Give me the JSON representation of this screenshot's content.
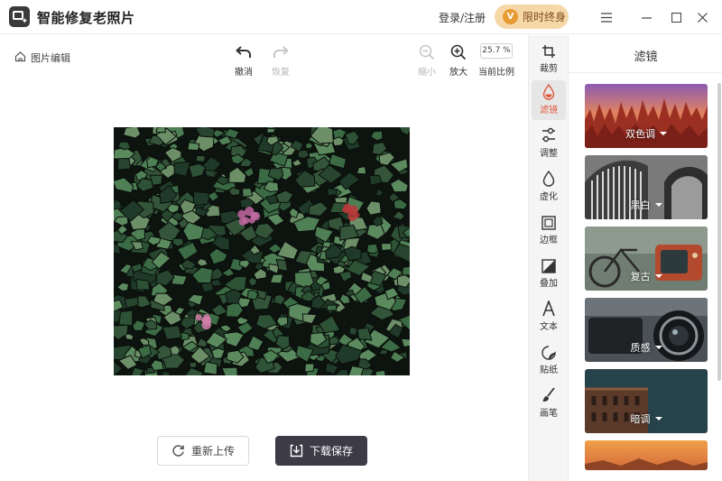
{
  "app": {
    "title": "智能修复老照片"
  },
  "header": {
    "login": "登录/注册",
    "vip": "限时终身",
    "vip_icon": "V"
  },
  "toolbar": {
    "breadcrumb": "图片编辑",
    "undo": "撤消",
    "redo": "恢复",
    "zoom_out": "缩小",
    "zoom_in": "放大",
    "zoom_value": "25.7 %",
    "zoom_label": "当前比例"
  },
  "actions": {
    "reupload": "重新上传",
    "download": "下载保存"
  },
  "rail": [
    {
      "label": "裁剪",
      "icon": "crop-icon"
    },
    {
      "label": "滤镜",
      "icon": "filter-drop-icon",
      "active": true
    },
    {
      "label": "调整",
      "icon": "adjust-icon"
    },
    {
      "label": "虚化",
      "icon": "blur-drop-icon"
    },
    {
      "label": "边框",
      "icon": "frame-icon"
    },
    {
      "label": "叠加",
      "icon": "overlay-icon"
    },
    {
      "label": "文本",
      "icon": "text-icon"
    },
    {
      "label": "贴纸",
      "icon": "sticker-icon"
    },
    {
      "label": "画笔",
      "icon": "brush-icon"
    }
  ],
  "panel": {
    "title": "滤镜",
    "filters": [
      {
        "label": "双色调"
      },
      {
        "label": "黑白"
      },
      {
        "label": "复古"
      },
      {
        "label": "质感"
      },
      {
        "label": "暗调"
      },
      {
        "label": ""
      }
    ]
  },
  "colors": {
    "accent": "#e0563b",
    "download_bg": "#3d3b46",
    "vip_bg": "#f6d7a8"
  }
}
